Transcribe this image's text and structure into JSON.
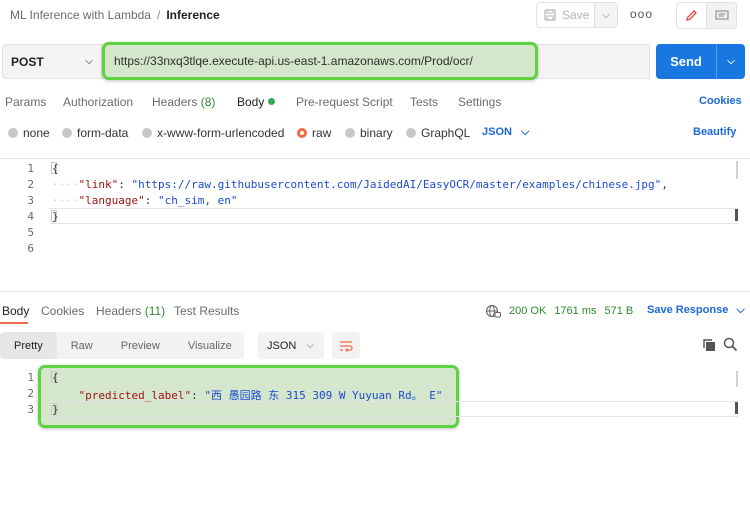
{
  "breadcrumb": {
    "parent": "ML Inference with Lambda",
    "separator": "/",
    "current": "Inference"
  },
  "toolbar": {
    "save_label": "Save",
    "more_label": "ooo"
  },
  "request": {
    "method": "POST",
    "url": "https://33nxq3tlqe.execute-api.us-east-1.amazonaws.com/Prod/ocr/",
    "send_label": "Send"
  },
  "request_tabs": {
    "params": "Params",
    "authorization": "Authorization",
    "headers": "Headers",
    "headers_count": "(8)",
    "body": "Body",
    "prerequest": "Pre-request Script",
    "tests": "Tests",
    "settings": "Settings",
    "cookies": "Cookies"
  },
  "body_types": {
    "none": "none",
    "form_data": "form-data",
    "urlencoded": "x-www-form-urlencoded",
    "raw": "raw",
    "binary": "binary",
    "graphql": "GraphQL",
    "format": "JSON",
    "beautify": "Beautify"
  },
  "request_body": {
    "line_numbers": [
      "1",
      "2",
      "3",
      "4",
      "5",
      "6"
    ],
    "open_brace": "{",
    "close_brace": "}",
    "link_key": "\"link\"",
    "link_value": "\"https://raw.githubusercontent.com/JaidedAI/EasyOCR/master/examples/chinese.jpg\"",
    "language_key": "\"language\"",
    "language_value": "\"ch_sim, en\""
  },
  "response_tabs": {
    "body": "Body",
    "cookies": "Cookies",
    "headers": "Headers",
    "headers_count": "(11)",
    "test_results": "Test Results"
  },
  "response_status": {
    "status": "200 OK",
    "time": "1761 ms",
    "size": "571 B",
    "save_response": "Save Response"
  },
  "response_view": {
    "pretty": "Pretty",
    "raw": "Raw",
    "preview": "Preview",
    "visualize": "Visualize",
    "format": "JSON"
  },
  "response_body": {
    "line_numbers": [
      "1",
      "2",
      "3"
    ],
    "open_brace": "{",
    "close_brace": "}",
    "key": "\"predicted_label\"",
    "value": "\"西 愚园路 东 315 309 W Yuyuan Rd。 E\""
  },
  "colors": {
    "accent": "#1877e0",
    "highlight_border": "#5ed23f",
    "highlight_fill": "#d4e6cc",
    "active_tab": "#ee6c4d"
  }
}
